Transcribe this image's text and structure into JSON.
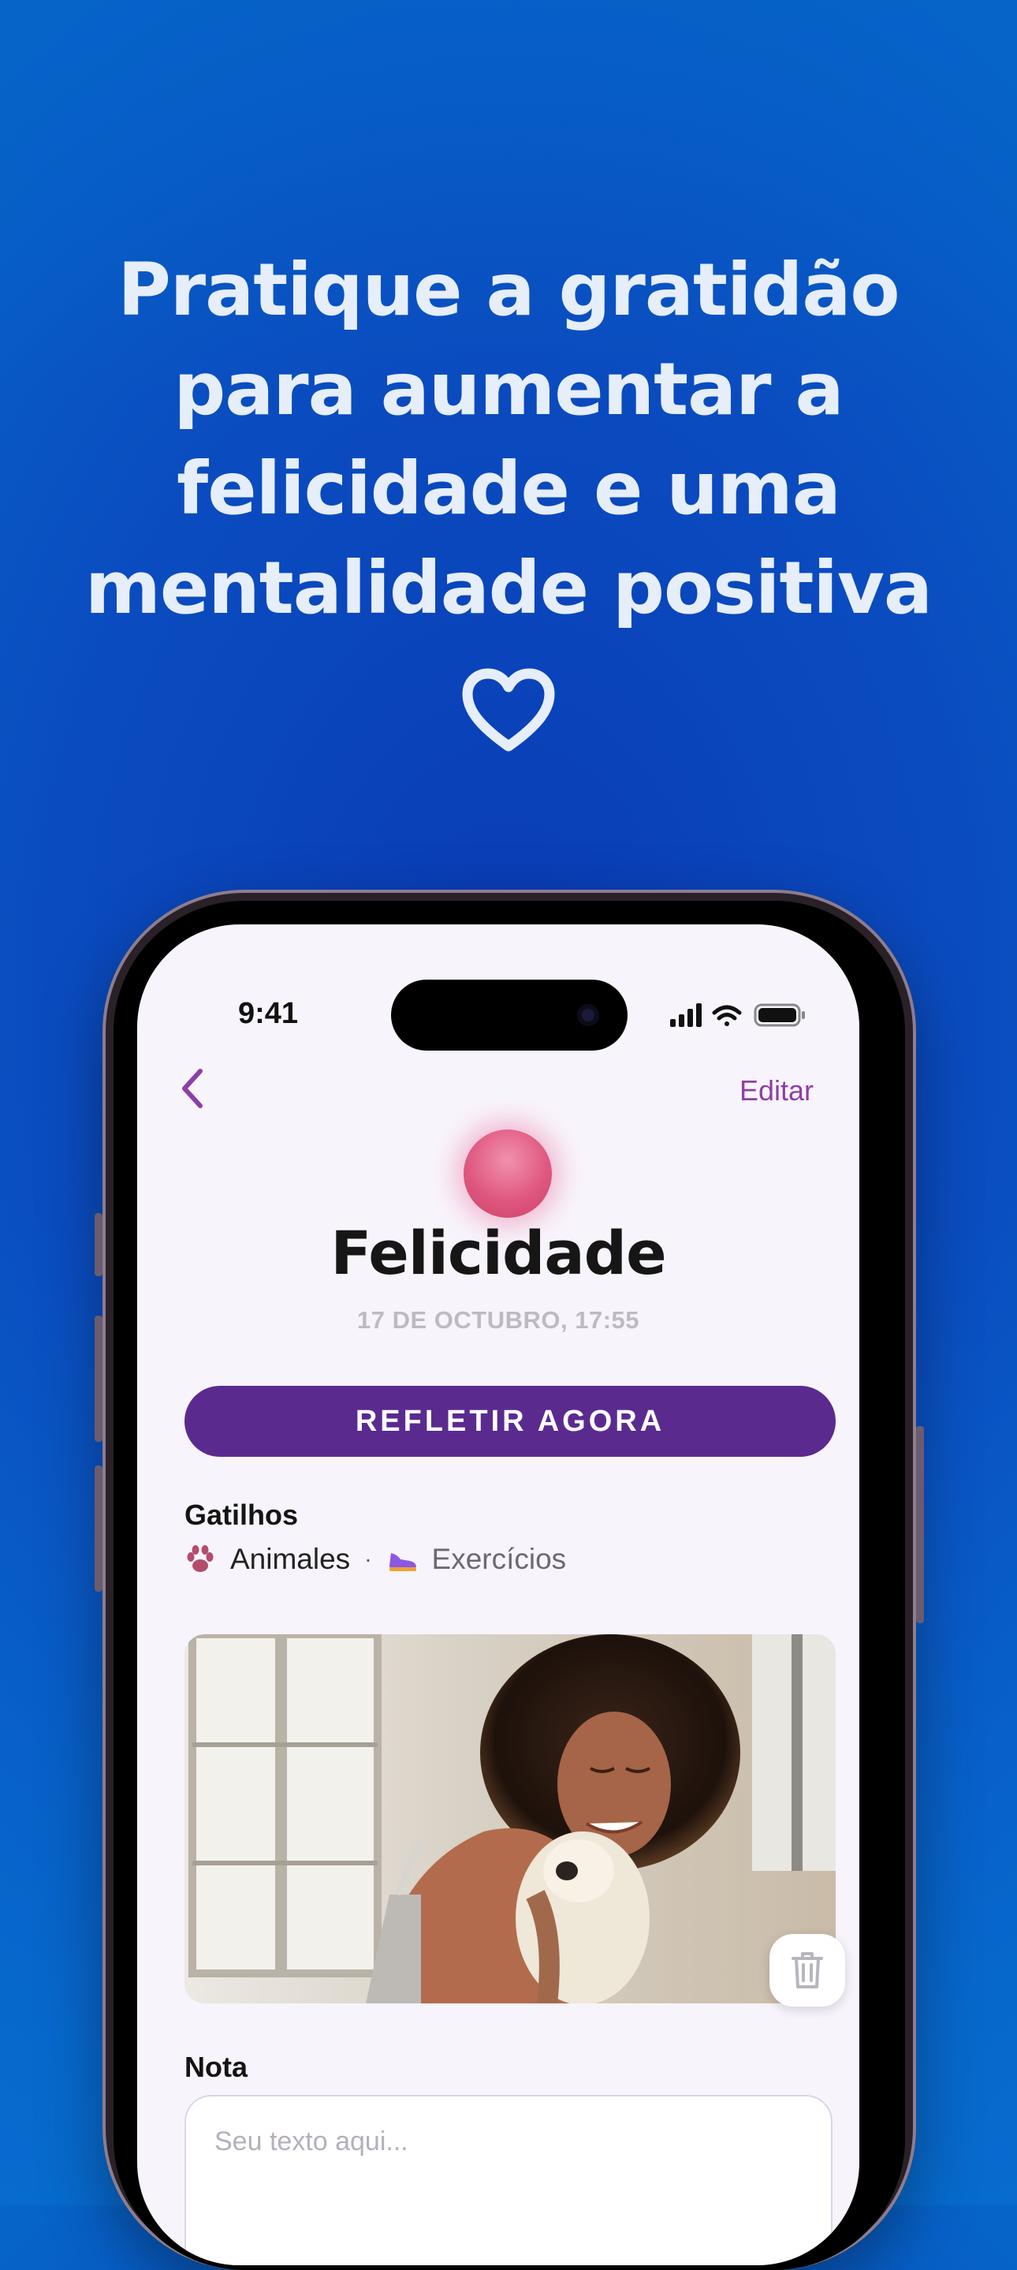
{
  "promo": {
    "headline": "Pratique a gratidão para aumentar a felicidade e uma mentalidade positiva",
    "heart_icon": "heart-outline-icon"
  },
  "status_bar": {
    "time": "9:41",
    "icons": [
      "signal-icon",
      "wifi-icon",
      "battery-icon"
    ]
  },
  "nav": {
    "back_icon": "chevron-left-icon",
    "edit_label": "Editar",
    "accent_color": "#8e3fa6"
  },
  "entry": {
    "mood": "Felicidade",
    "mood_color": "#e0587f",
    "date": "17 DE OCTUBRO, 17:55",
    "reflect_label": "REFLETIR AGORA",
    "reflect_color": "#5b2a8f"
  },
  "triggers": {
    "title": "Gatilhos",
    "items": [
      {
        "label": "Animales",
        "icon": "paw-icon"
      },
      {
        "label": "Exercícios",
        "icon": "sneaker-icon"
      }
    ],
    "separator": "·"
  },
  "photo": {
    "delete_icon": "trash-icon"
  },
  "note": {
    "title": "Nota",
    "placeholder": "Seu texto aqui..."
  }
}
